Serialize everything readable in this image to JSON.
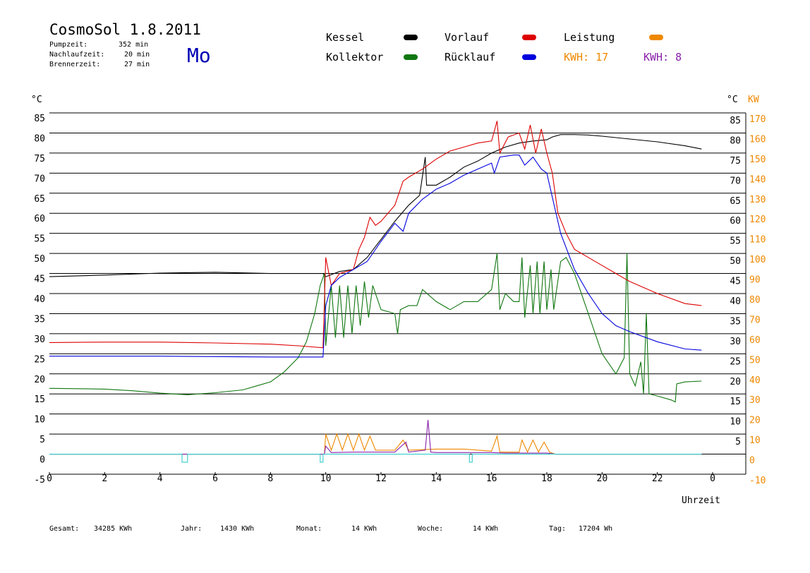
{
  "header": {
    "title": "CosmoSol 1.8.2011",
    "stats": [
      {
        "label": "Pumpzeit:",
        "value": "352 min"
      },
      {
        "label": "Nachlaufzeit:",
        "value": "20 min"
      },
      {
        "label": "Brennerzeit:",
        "value": "27 min"
      }
    ],
    "weekday": "Mo"
  },
  "legend": {
    "kessel": {
      "label": "Kessel",
      "color": "#000000"
    },
    "kollektor": {
      "label": "Kollektor",
      "color": "#117711"
    },
    "vorlauf": {
      "label": "Vorlauf",
      "color": "#dd0000"
    },
    "ruecklauf": {
      "label": "Rücklauf",
      "color": "#0000dd"
    },
    "leistung": {
      "label": "Leistung",
      "color": "#ee8800"
    },
    "kwh1": "KWH: 17",
    "kwh2": "KWH: 8",
    "kwh1_color": "#ee8800",
    "kwh2_color": "#8822aa"
  },
  "axes": {
    "left_unit": "°C",
    "right_unit": "°C",
    "power_unit": "KW",
    "x_label": "Uhrzeit"
  },
  "footer": {
    "gesamt_label": "Gesamt:",
    "gesamt_value": "34285 KWh",
    "jahr_label": "Jahr:",
    "jahr_value": "1430 KWh",
    "monat_label": "Monat:",
    "monat_value": "14 KWh",
    "woche_label": "Woche:",
    "woche_value": "14 KWh",
    "tag_label": "Tag:",
    "tag_value": "17204 Wh"
  },
  "chart_data": {
    "type": "line",
    "grid": true,
    "x_range": [
      0,
      24
    ],
    "x_ticks": [
      0,
      2,
      4,
      6,
      8,
      10,
      12,
      14,
      16,
      18,
      20,
      22,
      0
    ],
    "ylim": [
      -5,
      85
    ],
    "y_ticks_left": [
      85,
      80,
      75,
      70,
      65,
      60,
      55,
      50,
      45,
      40,
      35,
      30,
      25,
      20,
      15,
      10,
      5,
      0,
      -5
    ],
    "y_ticks_right": [
      85,
      80,
      75,
      70,
      65,
      60,
      55,
      50,
      45,
      40,
      35,
      30,
      25,
      20,
      15,
      10,
      5
    ],
    "y2_ticks": [
      170,
      160,
      150,
      140,
      130,
      120,
      110,
      100,
      90,
      80,
      70,
      60,
      50,
      40,
      30,
      20,
      10,
      0,
      -10
    ],
    "series": [
      {
        "name": "Kessel",
        "color": "#000000",
        "points": [
          [
            0,
            44.2
          ],
          [
            2,
            44.6
          ],
          [
            4,
            45.1
          ],
          [
            6,
            45.3
          ],
          [
            8,
            45
          ],
          [
            9.9,
            45
          ],
          [
            10,
            44.2
          ],
          [
            10.5,
            45.5
          ],
          [
            11,
            46
          ],
          [
            11.5,
            49
          ],
          [
            12,
            53.5
          ],
          [
            12.5,
            58
          ],
          [
            13,
            62
          ],
          [
            13.4,
            64.5
          ],
          [
            13.6,
            74
          ],
          [
            13.65,
            67
          ],
          [
            14,
            67
          ],
          [
            14.5,
            69
          ],
          [
            15,
            71.5
          ],
          [
            15.5,
            73
          ],
          [
            16,
            75
          ],
          [
            16.5,
            76.5
          ],
          [
            17,
            77.5
          ],
          [
            17.5,
            78
          ],
          [
            18,
            78.3
          ],
          [
            18.2,
            79
          ],
          [
            18.5,
            79.6
          ],
          [
            19,
            79.6
          ],
          [
            19.5,
            79.5
          ],
          [
            20,
            79.2
          ],
          [
            21,
            78.5
          ],
          [
            22,
            77.8
          ],
          [
            23,
            76.8
          ],
          [
            23.6,
            76
          ]
        ]
      },
      {
        "name": "Kollektor",
        "color": "#117711",
        "points": [
          [
            0,
            16.4
          ],
          [
            1,
            16.3
          ],
          [
            2,
            16.2
          ],
          [
            3,
            15.8
          ],
          [
            4,
            15.2
          ],
          [
            5,
            14.8
          ],
          [
            6,
            15.3
          ],
          [
            7,
            16
          ],
          [
            7.5,
            17
          ],
          [
            8,
            18
          ],
          [
            8.5,
            20.5
          ],
          [
            9,
            24
          ],
          [
            9.3,
            28
          ],
          [
            9.6,
            35
          ],
          [
            9.8,
            42
          ],
          [
            9.95,
            45
          ],
          [
            10,
            27
          ],
          [
            10.2,
            42
          ],
          [
            10.35,
            29
          ],
          [
            10.5,
            42
          ],
          [
            10.65,
            29
          ],
          [
            10.8,
            42
          ],
          [
            10.95,
            30
          ],
          [
            11.1,
            42
          ],
          [
            11.25,
            32
          ],
          [
            11.4,
            43
          ],
          [
            11.55,
            34
          ],
          [
            11.7,
            42
          ],
          [
            12,
            36
          ],
          [
            12.5,
            35
          ],
          [
            12.6,
            30
          ],
          [
            12.7,
            36
          ],
          [
            13,
            37
          ],
          [
            13.3,
            37
          ],
          [
            13.5,
            41
          ],
          [
            14,
            38
          ],
          [
            14.5,
            36
          ],
          [
            15,
            38
          ],
          [
            15.5,
            38
          ],
          [
            16,
            41
          ],
          [
            16.2,
            50
          ],
          [
            16.3,
            36
          ],
          [
            16.5,
            40
          ],
          [
            16.8,
            38
          ],
          [
            17,
            38
          ],
          [
            17.1,
            49
          ],
          [
            17.2,
            34
          ],
          [
            17.4,
            47
          ],
          [
            17.5,
            35
          ],
          [
            17.65,
            48
          ],
          [
            17.75,
            35
          ],
          [
            17.9,
            48
          ],
          [
            18,
            36
          ],
          [
            18.15,
            46
          ],
          [
            18.25,
            36
          ],
          [
            18.5,
            48
          ],
          [
            18.7,
            49
          ],
          [
            19,
            45
          ],
          [
            19.5,
            35
          ],
          [
            20,
            25
          ],
          [
            20.5,
            20
          ],
          [
            20.8,
            24
          ],
          [
            20.9,
            50
          ],
          [
            21,
            20
          ],
          [
            21.2,
            17
          ],
          [
            21.4,
            23
          ],
          [
            21.5,
            15
          ],
          [
            21.6,
            35
          ],
          [
            21.7,
            15
          ],
          [
            22,
            14.5
          ],
          [
            22.5,
            13.5
          ],
          [
            22.65,
            13
          ],
          [
            22.7,
            17.5
          ],
          [
            23,
            18
          ],
          [
            23.6,
            18.2
          ]
        ]
      },
      {
        "name": "Vorlauf",
        "color": "#dd0000",
        "points": [
          [
            0,
            27.8
          ],
          [
            2,
            27.9
          ],
          [
            4,
            27.9
          ],
          [
            6,
            27.7
          ],
          [
            8,
            27.4
          ],
          [
            9,
            27
          ],
          [
            9.9,
            26.5
          ],
          [
            10,
            49
          ],
          [
            10.2,
            42
          ],
          [
            10.5,
            45
          ],
          [
            11,
            46
          ],
          [
            11.2,
            51
          ],
          [
            11.4,
            54
          ],
          [
            11.6,
            59
          ],
          [
            11.8,
            57
          ],
          [
            12,
            58
          ],
          [
            12.5,
            62
          ],
          [
            12.8,
            68
          ],
          [
            13,
            69
          ],
          [
            13.5,
            71
          ],
          [
            14,
            73.5
          ],
          [
            14.5,
            75.5
          ],
          [
            15,
            76.5
          ],
          [
            15.5,
            77.5
          ],
          [
            16,
            78
          ],
          [
            16.2,
            83
          ],
          [
            16.3,
            75
          ],
          [
            16.6,
            79
          ],
          [
            17,
            80
          ],
          [
            17.2,
            76
          ],
          [
            17.4,
            82
          ],
          [
            17.6,
            75
          ],
          [
            17.8,
            81
          ],
          [
            18,
            75
          ],
          [
            18.2,
            70
          ],
          [
            18.4,
            60
          ],
          [
            18.7,
            55
          ],
          [
            19,
            51
          ],
          [
            19.5,
            49
          ],
          [
            20,
            47
          ],
          [
            21,
            43
          ],
          [
            22,
            40
          ],
          [
            23,
            37.5
          ],
          [
            23.6,
            37
          ]
        ]
      },
      {
        "name": "Rücklauf",
        "color": "#0000dd",
        "points": [
          [
            0,
            24.4
          ],
          [
            2,
            24.4
          ],
          [
            4,
            24.4
          ],
          [
            6,
            24.3
          ],
          [
            8,
            24.2
          ],
          [
            9.9,
            24.2
          ],
          [
            10,
            37
          ],
          [
            10.2,
            42
          ],
          [
            10.5,
            44
          ],
          [
            11,
            46
          ],
          [
            11.5,
            48
          ],
          [
            12,
            53
          ],
          [
            12.5,
            57.5
          ],
          [
            12.8,
            55.5
          ],
          [
            13,
            60
          ],
          [
            13.5,
            63.5
          ],
          [
            14,
            66
          ],
          [
            14.5,
            67.5
          ],
          [
            15,
            69.5
          ],
          [
            15.5,
            71
          ],
          [
            16,
            72.5
          ],
          [
            16.1,
            70
          ],
          [
            16.3,
            74
          ],
          [
            16.8,
            74.5
          ],
          [
            17,
            74.5
          ],
          [
            17.2,
            72
          ],
          [
            17.5,
            74
          ],
          [
            17.8,
            71
          ],
          [
            18,
            70
          ],
          [
            18.2,
            64
          ],
          [
            18.5,
            55
          ],
          [
            19,
            46
          ],
          [
            19.5,
            40
          ],
          [
            20,
            35
          ],
          [
            20.5,
            32
          ],
          [
            21,
            30.5
          ],
          [
            22,
            28
          ],
          [
            23,
            26.2
          ],
          [
            23.6,
            25.9
          ]
        ]
      },
      {
        "name": "Leistung",
        "color": "#ee8800",
        "axis": "right",
        "points": [
          [
            0,
            0
          ],
          [
            9.95,
            0
          ],
          [
            10,
            10
          ],
          [
            10.2,
            2
          ],
          [
            10.4,
            10
          ],
          [
            10.6,
            2
          ],
          [
            10.8,
            10
          ],
          [
            11,
            2
          ],
          [
            11.2,
            10
          ],
          [
            11.4,
            2
          ],
          [
            11.6,
            9
          ],
          [
            11.8,
            2
          ],
          [
            12.5,
            2
          ],
          [
            12.8,
            7
          ],
          [
            13,
            2
          ],
          [
            14,
            2.5
          ],
          [
            15,
            2.5
          ],
          [
            16,
            1.5
          ],
          [
            16.2,
            9
          ],
          [
            16.3,
            1
          ],
          [
            17,
            1
          ],
          [
            17.1,
            7
          ],
          [
            17.3,
            1
          ],
          [
            17.5,
            7
          ],
          [
            17.7,
            1
          ],
          [
            17.9,
            6
          ],
          [
            18.1,
            1
          ],
          [
            18.3,
            0
          ],
          [
            23.6,
            0
          ]
        ]
      },
      {
        "name": "Pumpe",
        "color": "#8822aa",
        "axis": "right",
        "points": [
          [
            0,
            0
          ],
          [
            9.95,
            0
          ],
          [
            10,
            4
          ],
          [
            10.2,
            0.8
          ],
          [
            11,
            1
          ],
          [
            12,
            1
          ],
          [
            12.5,
            1
          ],
          [
            12.9,
            6
          ],
          [
            13,
            1
          ],
          [
            13.6,
            2
          ],
          [
            13.7,
            17
          ],
          [
            13.8,
            1
          ],
          [
            14,
            0.8
          ],
          [
            15,
            0.8
          ],
          [
            16,
            0.8
          ],
          [
            16.5,
            0.5
          ],
          [
            17,
            0.5
          ],
          [
            18,
            0.5
          ],
          [
            18.3,
            0
          ],
          [
            23.6,
            0
          ]
        ]
      },
      {
        "name": "Status",
        "color": "#33cccc",
        "points": [
          [
            0,
            0
          ],
          [
            4.8,
            0
          ],
          [
            4.8,
            -2
          ],
          [
            5,
            -2
          ],
          [
            5,
            0
          ],
          [
            9.8,
            0
          ],
          [
            9.8,
            -2
          ],
          [
            9.9,
            -2
          ],
          [
            9.9,
            0
          ],
          [
            15.2,
            0
          ],
          [
            15.2,
            -2
          ],
          [
            15.3,
            -2
          ],
          [
            15.3,
            0
          ],
          [
            23.6,
            0
          ]
        ]
      }
    ]
  }
}
